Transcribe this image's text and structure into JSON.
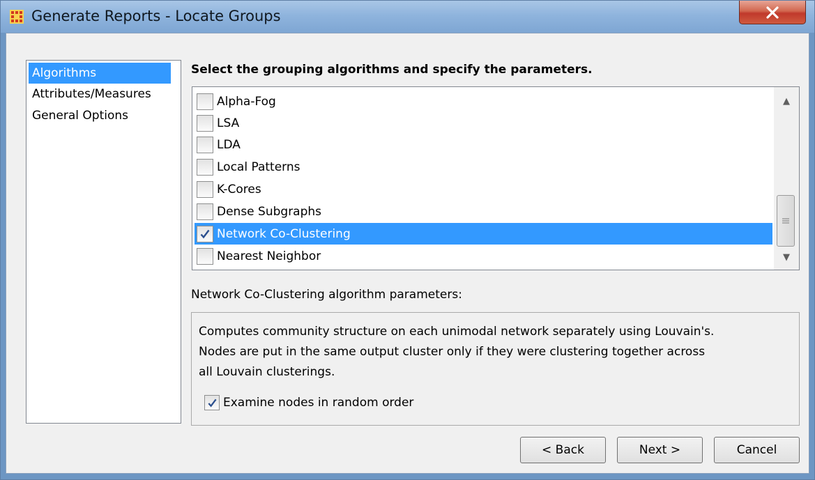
{
  "window": {
    "title": "Generate Reports - Locate Groups",
    "close_label": "X"
  },
  "nav": {
    "items": [
      {
        "label": "Algorithms",
        "selected": true
      },
      {
        "label": "Attributes/Measures",
        "selected": false
      },
      {
        "label": "General Options",
        "selected": false
      }
    ]
  },
  "main": {
    "heading": "Select the grouping algorithms and specify the parameters.",
    "algorithms": [
      {
        "label": "Alpha-Fog",
        "checked": false,
        "selected": false
      },
      {
        "label": "LSA",
        "checked": false,
        "selected": false
      },
      {
        "label": "LDA",
        "checked": false,
        "selected": false
      },
      {
        "label": "Local Patterns",
        "checked": false,
        "selected": false
      },
      {
        "label": "K-Cores",
        "checked": false,
        "selected": false
      },
      {
        "label": "Dense Subgraphs",
        "checked": false,
        "selected": false
      },
      {
        "label": "Network Co-Clustering",
        "checked": true,
        "selected": true
      },
      {
        "label": "Nearest Neighbor",
        "checked": false,
        "selected": false
      }
    ],
    "params_label": "Network Co-Clustering algorithm parameters:",
    "description_lines": [
      "Computes community structure on each unimodal network separately using Louvain's.",
      "Nodes are put in the same output cluster only if they were clustering together across",
      "all Louvain clusterings."
    ],
    "option": {
      "label": "Examine nodes in random order",
      "checked": true
    }
  },
  "buttons": {
    "back": "< Back",
    "next": "Next >",
    "cancel": "Cancel"
  },
  "colors": {
    "selection": "#3399ff",
    "titlebar": "#8fb4dd",
    "close": "#c0392b"
  },
  "icons": [
    "app-grid-icon",
    "close-icon",
    "checkmark-icon",
    "scroll-up-icon",
    "scroll-down-icon"
  ]
}
